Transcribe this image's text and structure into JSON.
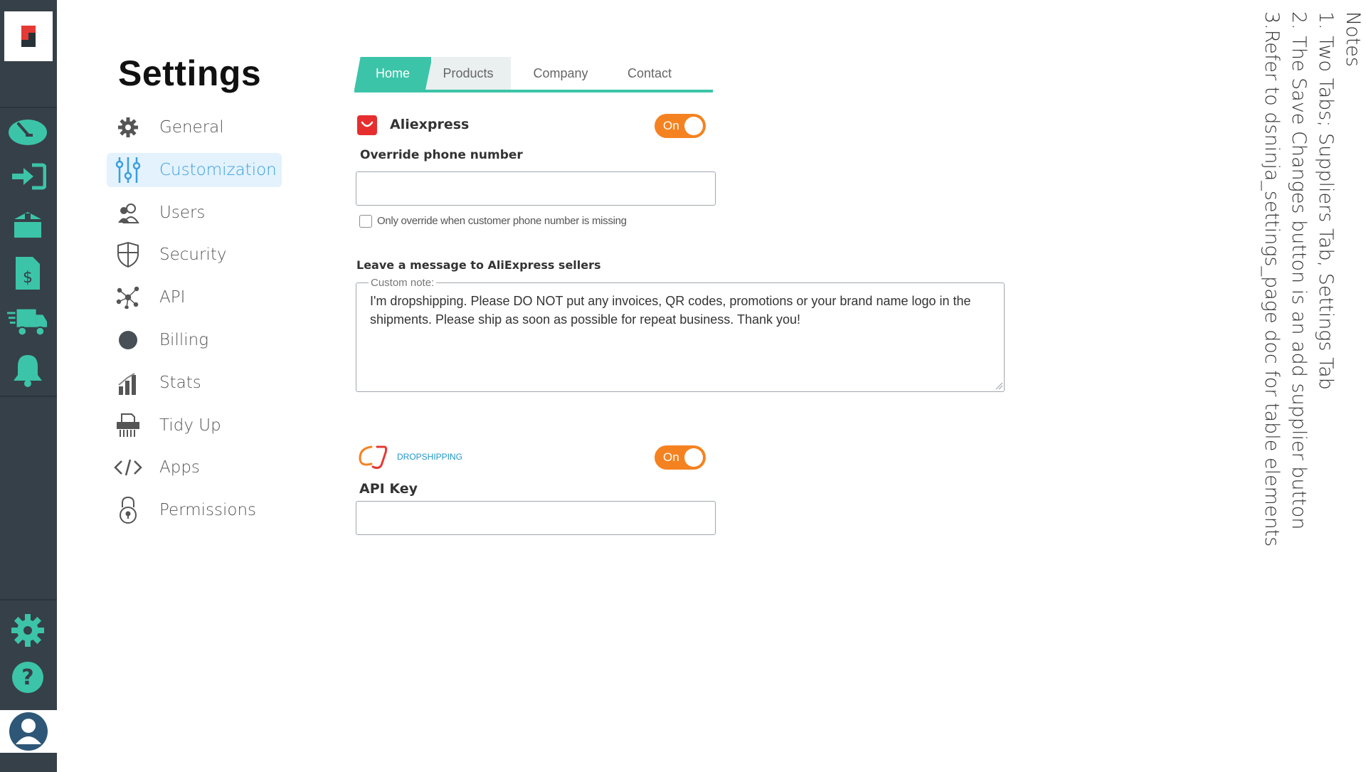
{
  "settings": {
    "title": "Settings",
    "menu": [
      {
        "label": "General",
        "icon": "gear-icon"
      },
      {
        "label": "Customization",
        "icon": "sliders-icon",
        "active": true
      },
      {
        "label": "Users",
        "icon": "users-icon"
      },
      {
        "label": "Security",
        "icon": "shield-icon"
      },
      {
        "label": "API",
        "icon": "network-icon"
      },
      {
        "label": "Billing",
        "icon": "circle-icon"
      },
      {
        "label": "Stats",
        "icon": "stats-icon"
      },
      {
        "label": "Tidy Up",
        "icon": "shredder-icon"
      },
      {
        "label": "Apps",
        "icon": "code-icon"
      },
      {
        "label": "Permissions",
        "icon": "lock-icon"
      }
    ]
  },
  "tabs": [
    {
      "label": "Home",
      "active": true
    },
    {
      "label": "Products"
    },
    {
      "label": "Company"
    },
    {
      "label": "Contact"
    }
  ],
  "aliexpress": {
    "name": "Aliexpress",
    "toggle": "On",
    "override_label": "Override phone number",
    "override_value": "",
    "checkbox_label": "Only override when customer phone number is missing",
    "message_label": "Leave a message to AliExpress sellers",
    "note_legend": "Custom note:",
    "note_text": "I'm dropshipping. Please DO NOT put any invoices, QR codes, promotions or your brand name logo in the shipments. Please ship as soon as possible for repeat business. Thank you!"
  },
  "cj": {
    "logo_text": "DROPSHIPPING",
    "toggle": "On",
    "api_key_label": "API Key",
    "api_key_value": ""
  },
  "notes": {
    "title": "Notes",
    "lines": [
      "1. Two Tabs; Suppliers Tab, Settings Tab",
      "2. The Save Changes button is an add supplier button",
      "3.Refer to dsninja_settings_page doc for table elements"
    ]
  },
  "colors": {
    "rail": "#364049",
    "rail_icon": "#3cc4a8",
    "tab_active": "#3cc4a8",
    "toggle": "#f58220",
    "menu_active": "#3a9fe0"
  }
}
